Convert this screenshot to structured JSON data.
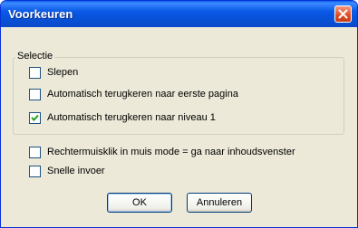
{
  "window": {
    "title": "Voorkeuren"
  },
  "group": {
    "legend": "Selectie"
  },
  "options": {
    "slepen": {
      "label": "Slepen",
      "checked": false
    },
    "eerste_pagina": {
      "label": "Automatisch terugkeren naar eerste pagina",
      "checked": false
    },
    "niveau_1": {
      "label": "Automatisch terugkeren naar niveau 1",
      "checked": true
    },
    "rechtermuisklik": {
      "label": "Rechtermuisklik in muis mode = ga naar inhoudsvenster",
      "checked": false
    },
    "snelle_invoer": {
      "label": "Snelle invoer",
      "checked": false
    }
  },
  "buttons": {
    "ok": "OK",
    "cancel": "Annuleren"
  },
  "icons": {
    "close": "close-icon",
    "check": "checkmark-icon"
  }
}
